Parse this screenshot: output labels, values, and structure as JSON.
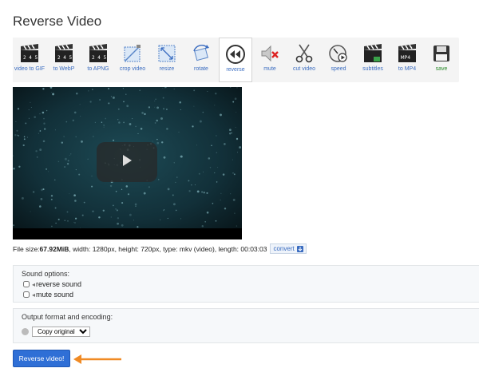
{
  "page": {
    "title": "Reverse Video"
  },
  "toolbar": {
    "items": [
      {
        "label": "video to GIF",
        "icon": "clapperboard-icon"
      },
      {
        "label": "to WebP",
        "icon": "clapperboard-icon"
      },
      {
        "label": "to APNG",
        "icon": "clapperboard-icon"
      },
      {
        "label": "crop video",
        "icon": "crop-icon"
      },
      {
        "label": "resize",
        "icon": "resize-icon"
      },
      {
        "label": "rotate",
        "icon": "rotate-icon"
      },
      {
        "label": "reverse",
        "icon": "rewind-icon",
        "active": true
      },
      {
        "label": "mute",
        "icon": "mute-speaker-icon"
      },
      {
        "label": "cut video",
        "icon": "scissors-icon"
      },
      {
        "label": "speed",
        "icon": "speedometer-icon"
      },
      {
        "label": "subtitles",
        "icon": "clapperboard-icon"
      },
      {
        "label": "to MP4",
        "icon": "clapperboard-icon"
      },
      {
        "label": "save",
        "icon": "floppy-disk-icon"
      }
    ]
  },
  "file_info": {
    "prefix": "File size: ",
    "size": "67.92MiB",
    "details": ", width: 1280px, height: 720px, type: mkv (video), length: 00:03:03",
    "convert_label": "convert"
  },
  "sound_options": {
    "title": "Sound options:",
    "reverse_sound": "reverse sound",
    "mute_sound": "mute sound"
  },
  "output_format": {
    "title": "Output format and encoding:",
    "selected": "Copy original"
  },
  "action": {
    "button_label": "Reverse video!"
  },
  "colors": {
    "accent": "#2f6fd6",
    "arrow": "#f08a24"
  }
}
